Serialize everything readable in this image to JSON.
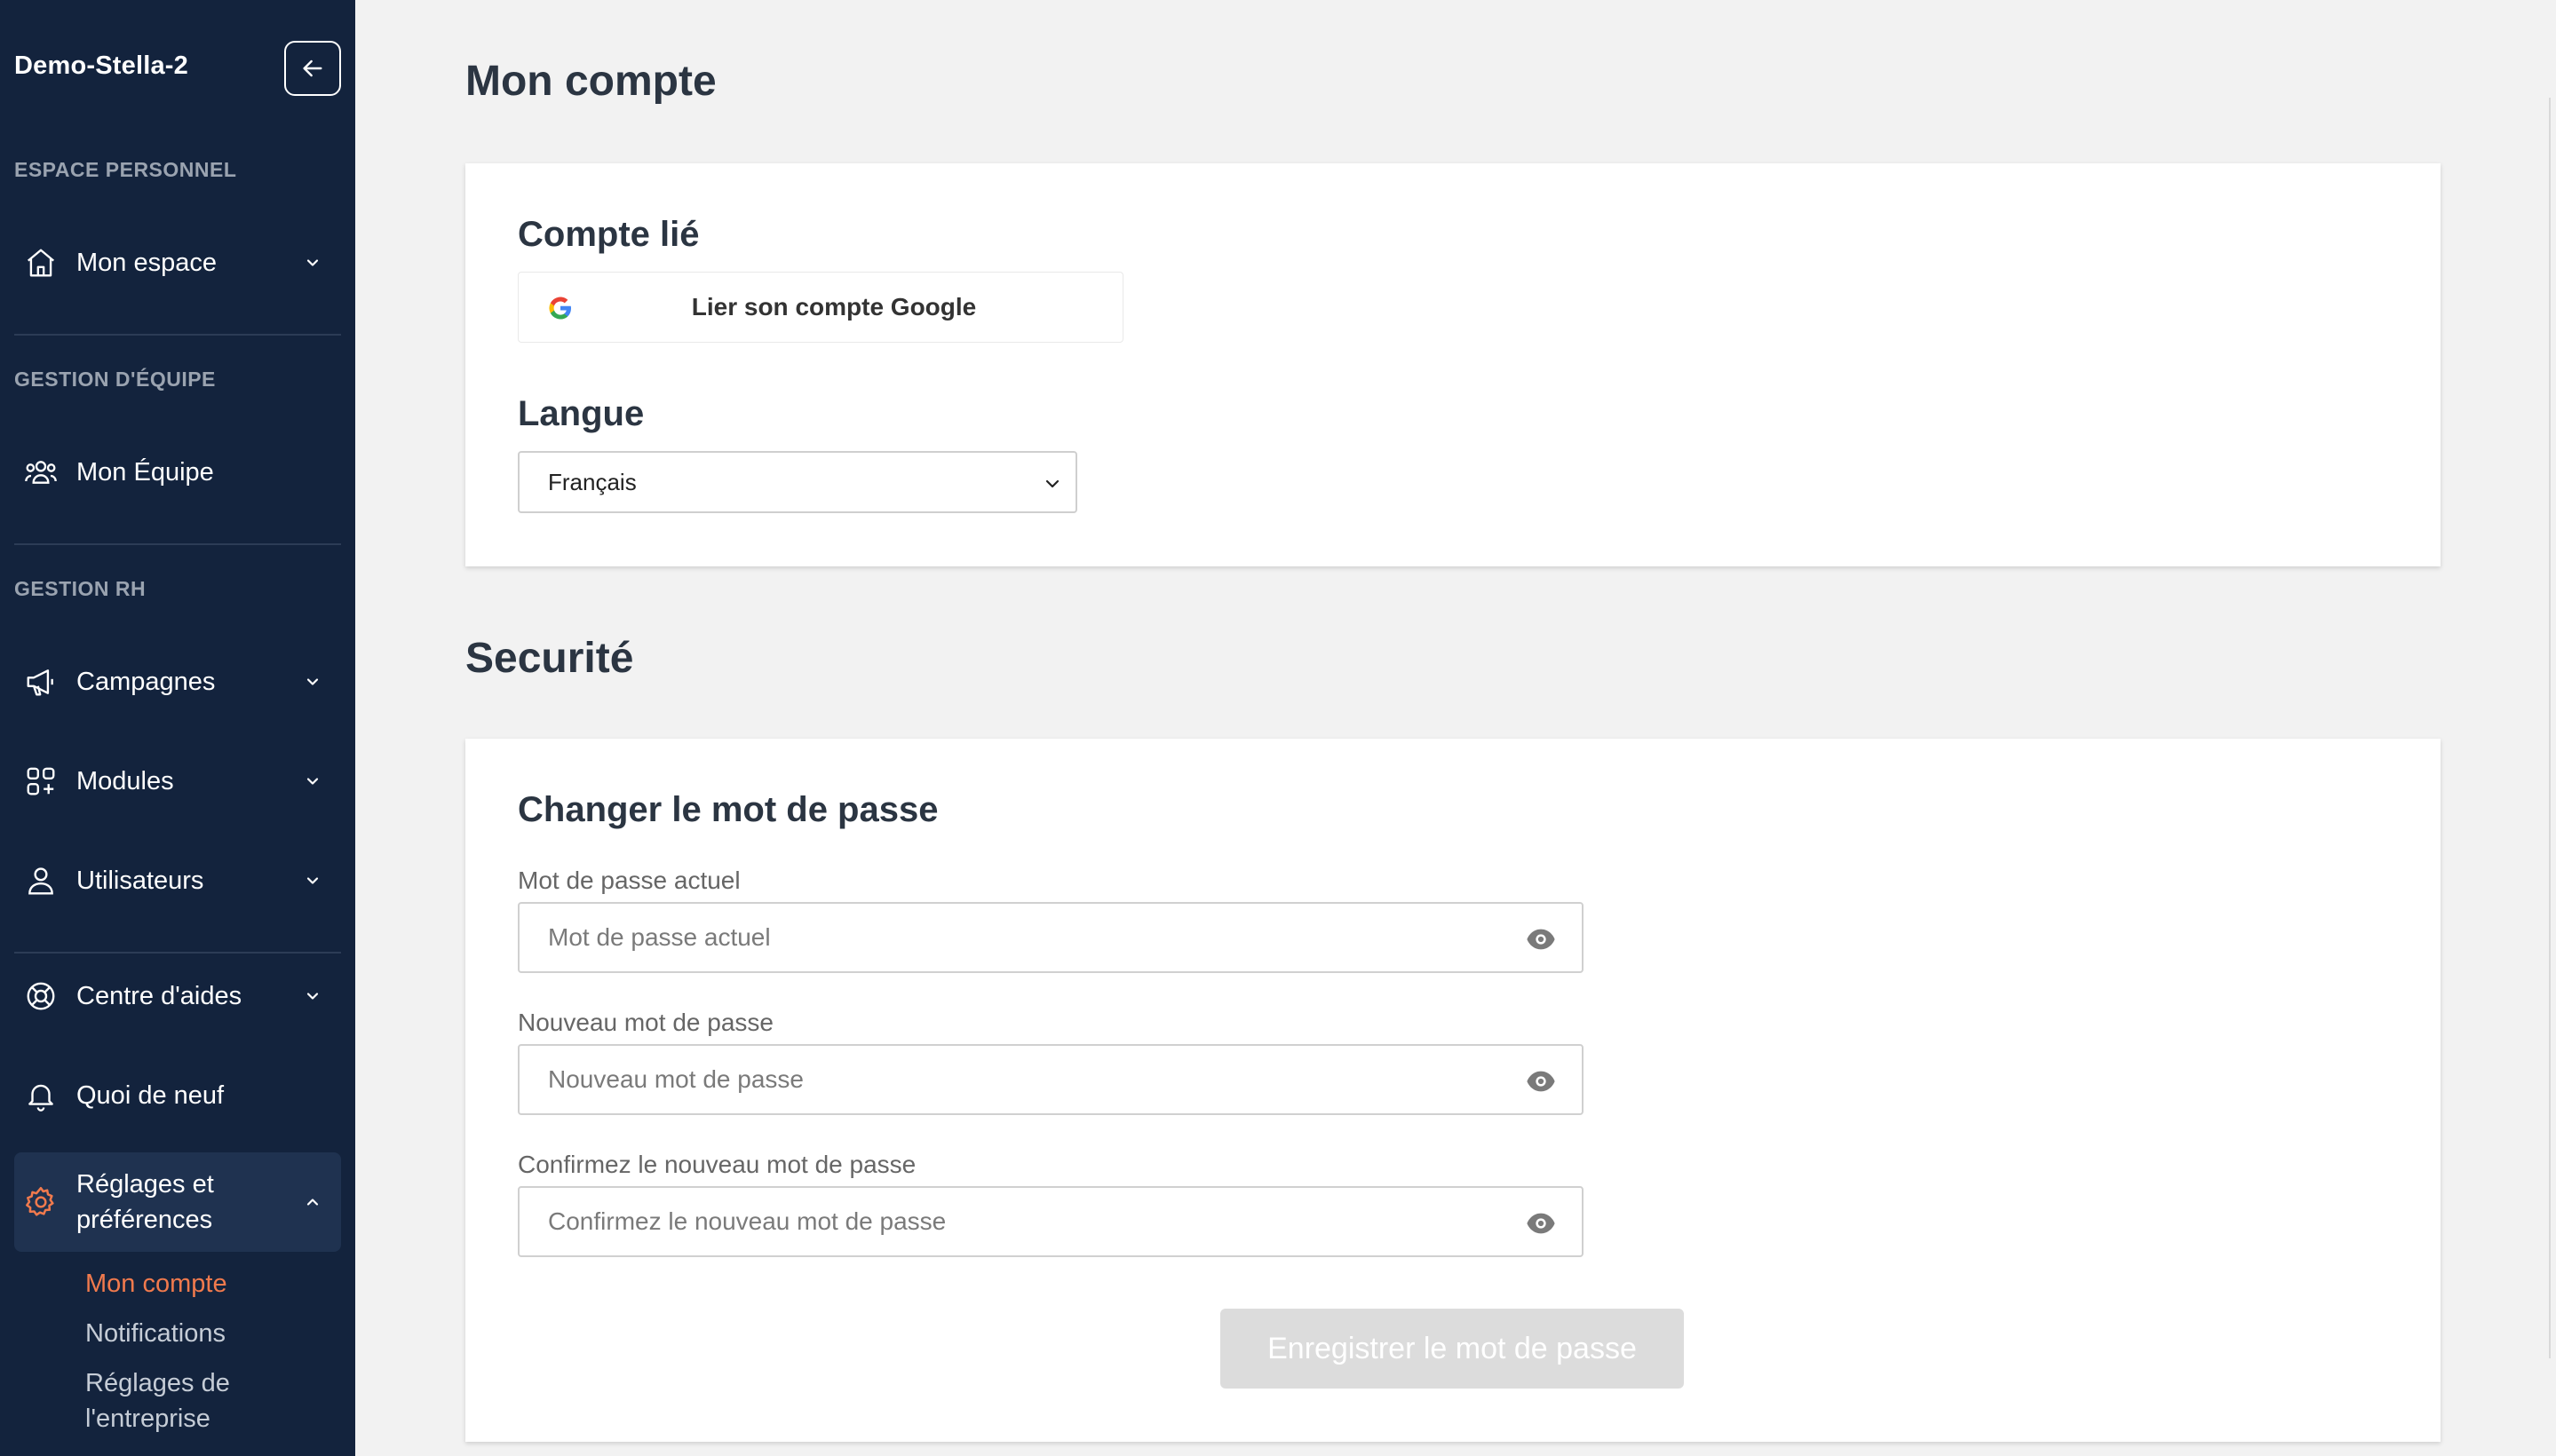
{
  "sidebar": {
    "workspace_name": "Demo-Stella-2",
    "sections": {
      "personal": "ESPACE PERSONNEL",
      "team": "GESTION D'ÉQUIPE",
      "hr": "GESTION RH"
    },
    "items": [
      {
        "label": "Mon espace",
        "icon": "home-icon"
      },
      {
        "label": "Mon Équipe",
        "icon": "team-icon"
      },
      {
        "label": "Campagnes",
        "icon": "megaphone-icon"
      },
      {
        "label": "Modules",
        "icon": "modules-grid-icon"
      },
      {
        "label": "Utilisateurs",
        "icon": "user-icon"
      },
      {
        "label": "Centre d'aides",
        "icon": "lifebuoy-icon"
      },
      {
        "label": "Quoi de neuf",
        "icon": "bell-icon"
      },
      {
        "label": "Réglages et préférences",
        "icon": "gear-icon"
      }
    ],
    "settings_subitems": [
      {
        "label": "Mon compte"
      },
      {
        "label": "Notifications"
      },
      {
        "label": "Réglages de l'entreprise"
      }
    ],
    "active_color": "#f17a4d"
  },
  "main": {
    "page_title": "Mon compte",
    "account_card": {
      "linked_title": "Compte lié",
      "google_button": "Lier son compte Google",
      "language_title": "Langue",
      "language_value": "Français"
    },
    "security_title": "Securité",
    "password_card": {
      "title": "Changer le mot de passe",
      "fields": [
        {
          "label": "Mot de passe actuel",
          "placeholder": "Mot de passe actuel"
        },
        {
          "label": "Nouveau mot de passe",
          "placeholder": "Nouveau mot de passe"
        },
        {
          "label": "Confirmez le nouveau mot de passe",
          "placeholder": "Confirmez le nouveau mot de passe"
        }
      ],
      "save_button": "Enregistrer le mot de passe"
    }
  }
}
